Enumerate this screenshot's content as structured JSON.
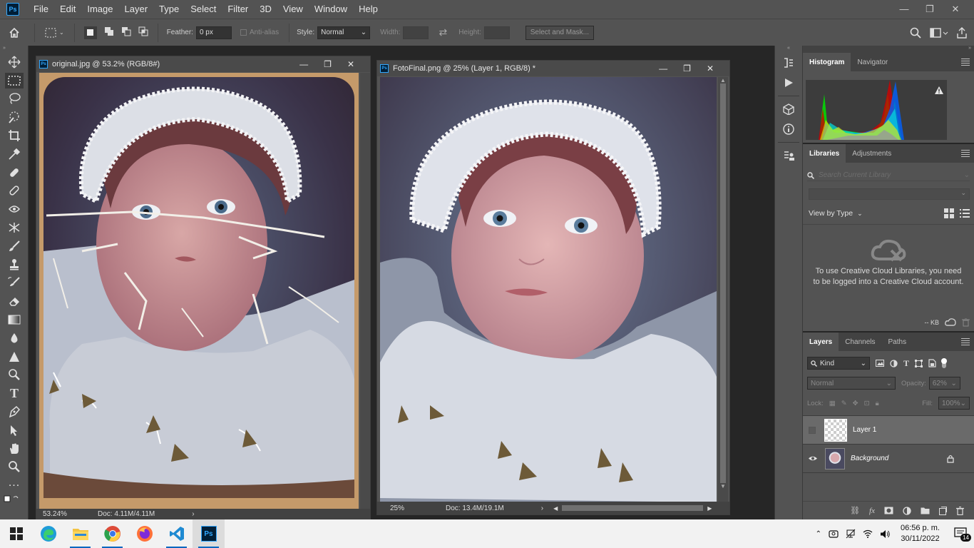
{
  "app": {
    "logo": "Ps"
  },
  "menu": [
    "File",
    "Edit",
    "Image",
    "Layer",
    "Type",
    "Select",
    "Filter",
    "3D",
    "View",
    "Window",
    "Help"
  ],
  "window_controls": {
    "minimize": "—",
    "restore": "❐",
    "close": "✕"
  },
  "options": {
    "feather_label": "Feather:",
    "feather_value": "0 px",
    "antialias_label": "Anti-alias",
    "style_label": "Style:",
    "style_value": "Normal",
    "width_label": "Width:",
    "height_label": "Height:",
    "select_mask_label": "Select and Mask..."
  },
  "doc1": {
    "title": "original.jpg @ 53.2% (RGB/8#)",
    "zoom": "53.24%",
    "doc_size": "Doc: 4.11M/4.11M"
  },
  "doc2": {
    "title": "FotoFinal.png @ 25% (Layer 1, RGB/8) *",
    "zoom": "25%",
    "doc_size": "Doc: 13.4M/19.1M"
  },
  "histogram_panel": {
    "tabs": [
      "Histogram",
      "Navigator"
    ]
  },
  "libraries_panel": {
    "tabs": [
      "Libraries",
      "Adjustments"
    ],
    "search_placeholder": "Search Current Library",
    "view_by": "View by Type",
    "message": "To use Creative Cloud Libraries, you need to be logged into a Creative Cloud account.",
    "size": "-- KB"
  },
  "layers_panel": {
    "tabs": [
      "Layers",
      "Channels",
      "Paths"
    ],
    "kind": "Kind",
    "blend_mode": "Normal",
    "opacity_label": "Opacity:",
    "opacity_value": "62%",
    "lock_label": "Lock:",
    "fill_label": "Fill:",
    "fill_value": "100%",
    "layers": [
      {
        "name": "Layer 1",
        "visible": false,
        "selected": true
      },
      {
        "name": "Background",
        "visible": true,
        "locked": true
      }
    ]
  },
  "taskbar": {
    "apps": [
      "windows-start",
      "edge",
      "file-explorer",
      "chrome",
      "firefox",
      "vscode",
      "photoshop"
    ],
    "time": "06:56 p. m.",
    "date": "30/11/2022",
    "notifications": "14"
  }
}
